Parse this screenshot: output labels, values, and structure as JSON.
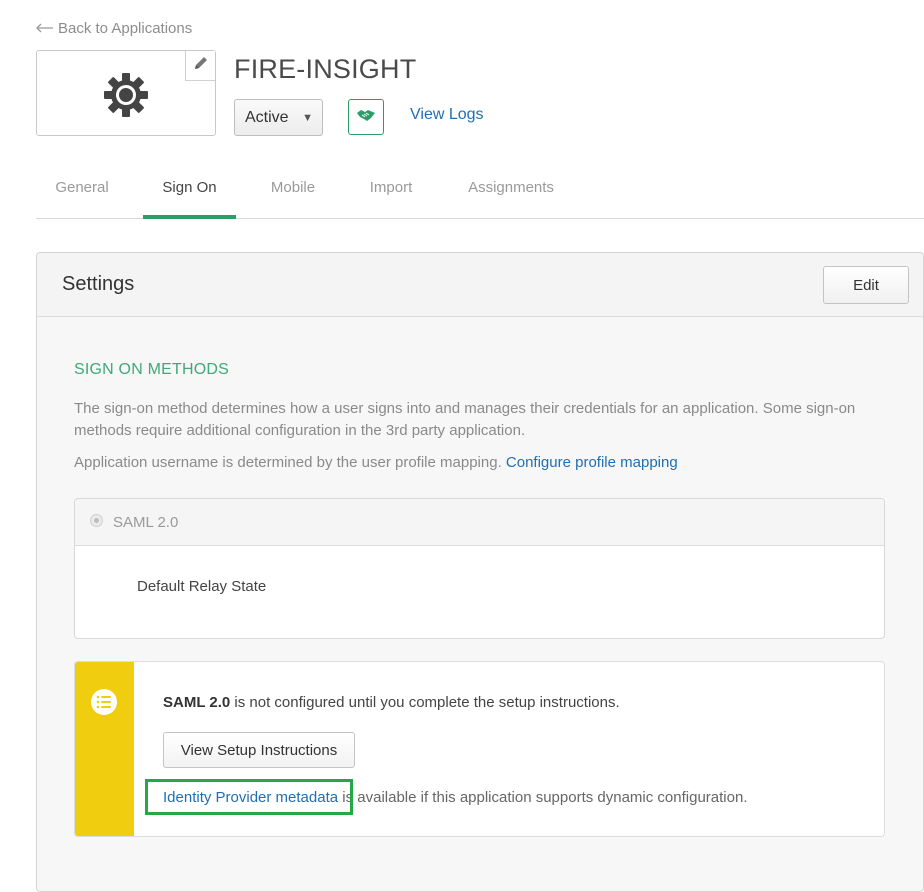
{
  "nav": {
    "back_label": "Back to Applications"
  },
  "app": {
    "title": "FIRE-INSIGHT",
    "status": "Active",
    "view_logs": "View Logs"
  },
  "tabs": [
    {
      "label": "General"
    },
    {
      "label": "Sign On",
      "active": true
    },
    {
      "label": "Mobile"
    },
    {
      "label": "Import"
    },
    {
      "label": "Assignments"
    }
  ],
  "settings": {
    "title": "Settings",
    "edit_label": "Edit",
    "section_heading": "SIGN ON METHODS",
    "description": "The sign-on method determines how a user signs into and manages their credentials for an application. Some sign-on methods require additional configuration in the 3rd party application.",
    "username_text": "Application username is determined by the user profile mapping.",
    "username_link": "Configure profile mapping",
    "saml": {
      "label": "SAML 2.0",
      "relay_state_label": "Default Relay State"
    },
    "notice": {
      "bold": "SAML 2.0",
      "text": " is not configured until you complete the setup instructions.",
      "button": "View Setup Instructions",
      "link": "Identity Provider metadata",
      "link_suffix": " is available if this application supports dynamic configuration."
    }
  },
  "colors": {
    "accent_green": "#2e9c69",
    "section_green": "#41a879",
    "link_blue": "#1f6fb2",
    "notice_yellow": "#f0cd0e",
    "highlight_green": "#23a948"
  },
  "icons": [
    "back-arrow-icon",
    "gear-icon",
    "pencil-icon",
    "handshake-icon",
    "list-icon"
  ]
}
